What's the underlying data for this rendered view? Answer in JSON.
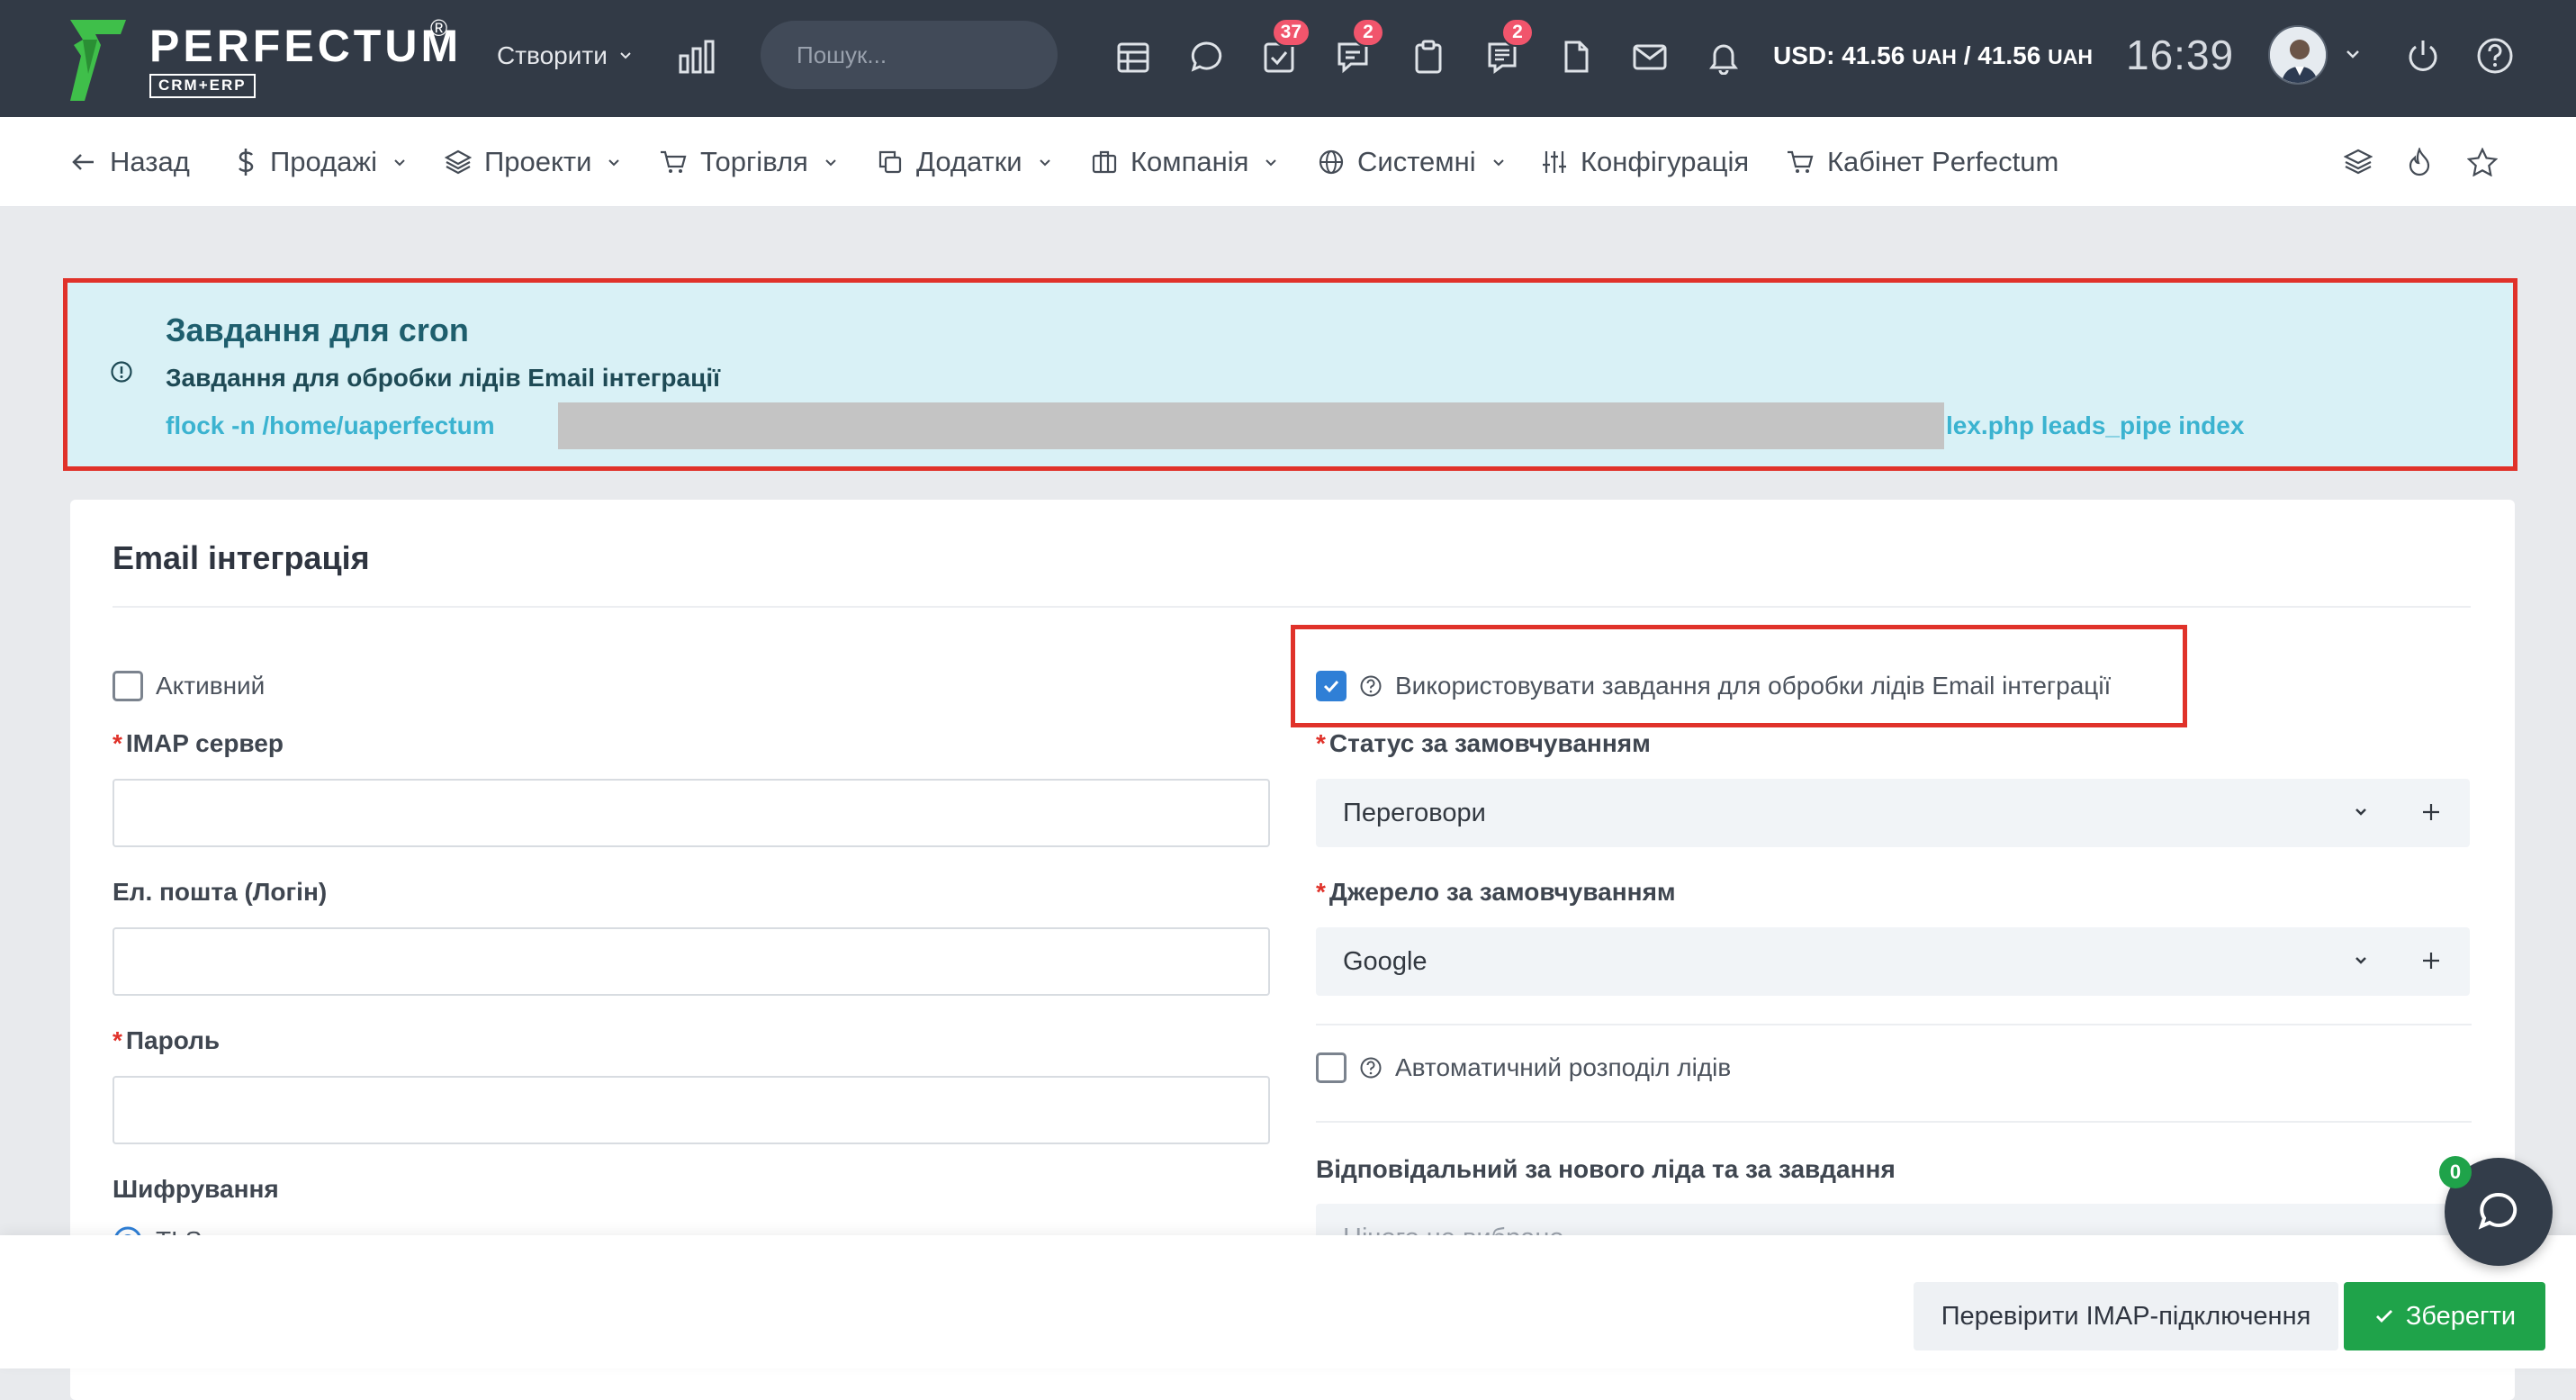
{
  "brand": {
    "name": "PERFECTUM",
    "reg": "®",
    "sub": "CRM+ERP"
  },
  "topbar": {
    "create_label": "Створити",
    "search_placeholder": "Пошук...",
    "badges": {
      "tasks": "37",
      "chat": "2",
      "notes": "2"
    },
    "currency_usd": "USD: 41.56",
    "currency_uah1": "UAH",
    "currency_sep": " / 41.56",
    "currency_uah2": "UAH",
    "time": "16:39"
  },
  "nav": {
    "back": "Назад",
    "sales": "Продажі",
    "projects": "Проекти",
    "trade": "Торгівля",
    "addons": "Додатки",
    "company": "Компанія",
    "system": "Системні",
    "config": "Конфігурація",
    "cabinet": "Кабінет Perfectum"
  },
  "alert": {
    "title": "Завдання для cron",
    "subtitle": "Завдання для обробки лідів Email інтеграції",
    "cmd_start": "flock -n /home/uaperfectum",
    "cmd_end": "lex.php leads_pipe index"
  },
  "card": {
    "title": "Email інтеграція",
    "active_label": "Активний",
    "imap_label": "IMAP сервер",
    "email_label": "Ел. пошта (Логін)",
    "password_label": "Пароль",
    "encryption_label": "Шифрування",
    "encryption_value": "TLS",
    "use_tasks_label": "Використовувати завдання для обробки лідів Email інтеграції",
    "status_label": "Статус за замовчуванням",
    "status_value": "Переговори",
    "source_label": "Джерело за замовчуванням",
    "source_value": "Google",
    "auto_assign_label": "Автоматичний розподіл лідів",
    "responsible_label": "Відповідальний за нового ліда та за завдання",
    "responsible_placeholder": "Нічого не вибрано"
  },
  "footer": {
    "check_btn": "Перевірити IMAP-підключення",
    "save_btn": "Зберегти"
  },
  "chat": {
    "count": "0"
  },
  "colors": {
    "topbar_bg": "#323a46",
    "accent_red": "#e0322a",
    "alert_bg": "#d9f1f6",
    "save_green": "#1fa34a",
    "checkbox_blue": "#2f7fd6",
    "badge_red": "#f1556c"
  },
  "icons": [
    "back-arrow-icon",
    "dollar-icon",
    "layers-icon",
    "cart-icon",
    "copy-icon",
    "briefcase-icon",
    "globe-icon",
    "sliders-icon",
    "cart-icon",
    "layers-icon",
    "fire-icon",
    "star-icon",
    "calendar-icon",
    "message-icon",
    "tasks-icon",
    "chat-icon",
    "clipboard-icon",
    "notes-icon",
    "file-icon",
    "mail-icon",
    "bell-icon",
    "power-icon",
    "help-icon",
    "info-icon",
    "question-icon",
    "chevron-down-icon",
    "plus-icon",
    "check-icon",
    "search-icon"
  ]
}
